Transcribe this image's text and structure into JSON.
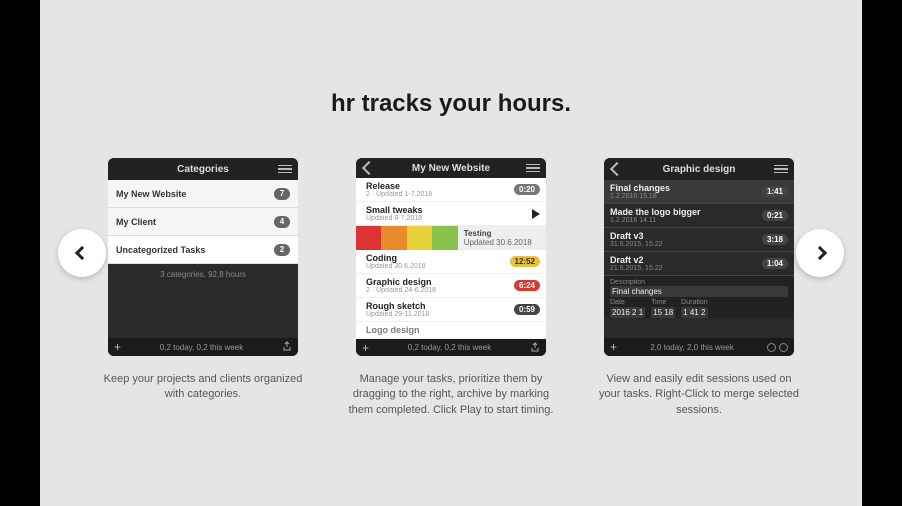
{
  "headline": "hr tracks your hours.",
  "panel1": {
    "title": "Categories",
    "rows": [
      {
        "label": "My New Website",
        "count": "7"
      },
      {
        "label": "My Client",
        "count": "4"
      },
      {
        "label": "Uncategorized Tasks",
        "count": "2"
      }
    ],
    "subline": "3 categories, 92,8 hours",
    "footer": "0,2 today, 0,2 this week",
    "caption": "Keep your projects and clients organized with categories."
  },
  "panel2": {
    "title": "My New Website",
    "rows": [
      {
        "name": "Release",
        "sub": "2 · Updated 1-7.2018",
        "pill": "0:20",
        "cls": "p-grey"
      },
      {
        "name": "Small tweaks",
        "sub": "Updated 8-7.2018",
        "play": true
      },
      {
        "name": "Testing",
        "sub": "Updated 30.6.2018",
        "drag": true
      },
      {
        "name": "Coding",
        "sub": "Updated 30.6.2018",
        "pill": "12:52",
        "cls": "p-yellow"
      },
      {
        "name": "Graphic design",
        "sub": "2 · Updated 24-6.2018",
        "pill": "6:24",
        "cls": "p-red"
      },
      {
        "name": "Rough sketch",
        "sub": "Updated 29-11.2018",
        "pill": "0:59",
        "cls": "p-dark"
      },
      {
        "name": "Logo design",
        "sub": "",
        "pill": "",
        "cls": ""
      }
    ],
    "footer": "0,2 today, 0,2 this week",
    "caption": "Manage your tasks, prioritize them by dragging to the right, archive by marking them completed. Click Play to start timing."
  },
  "panel3": {
    "title": "Graphic design",
    "rows": [
      {
        "name": "Final changes",
        "sub": "1.2.2016 15.18",
        "pill": "1:41",
        "sel": true
      },
      {
        "name": "Made the logo bigger",
        "sub": "1.2.2016 14.11",
        "pill": "0:21"
      },
      {
        "name": "Draft v3",
        "sub": "31.6.2015, 15:22",
        "pill": "3:18"
      },
      {
        "name": "Draft v2",
        "sub": "21.6.2015, 15:22",
        "pill": "1:04"
      }
    ],
    "form": {
      "desc_label": "Description",
      "desc_value": "Final changes",
      "date_label": "Date",
      "date_value": "2016  2  1",
      "time_label": "Time",
      "time_value": "15 18",
      "dur_label": "Duration",
      "dur_value": "1 41  2"
    },
    "footer": "2,0 today, 2,0 this week",
    "caption": "View and easily edit sessions used on your tasks. Right-Click to merge selected sessions."
  }
}
